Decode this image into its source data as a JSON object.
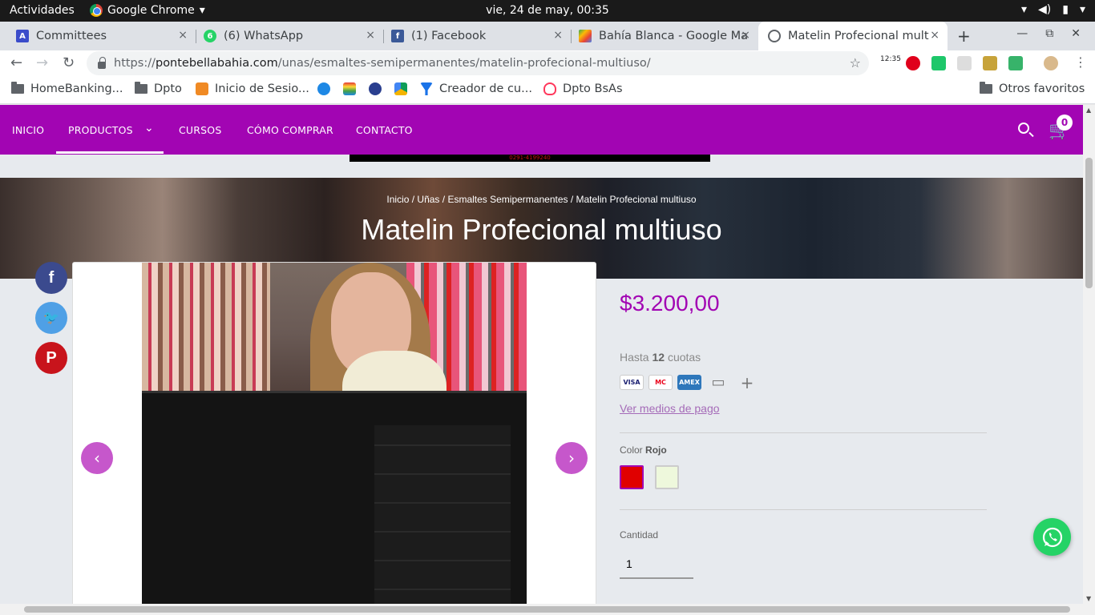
{
  "os": {
    "activities": "Actividades",
    "app_name": "Google Chrome",
    "app_menu_icon": "▾",
    "clock": "vie, 24 de may, 00:35"
  },
  "tabs": [
    {
      "title": "Committees",
      "close": "×"
    },
    {
      "title": "(6) WhatsApp",
      "badge": "6",
      "close": "×"
    },
    {
      "title": "(1) Facebook",
      "close": "×"
    },
    {
      "title": "Bahía Blanca - Google Ma",
      "close": "×"
    },
    {
      "title": "Matelin Profecional mult",
      "close": "×"
    }
  ],
  "browser": {
    "url_scheme": "https://",
    "url_host": "pontebellabahia.com",
    "url_path": "/unas/esmaltes-semipermanentes/matelin-profecional-multiuso/",
    "ext_clock_label": "12:35"
  },
  "bookmarks": [
    {
      "label": "HomeBanking...",
      "icon": "folder-icon"
    },
    {
      "label": "Dpto",
      "icon": "folder-icon"
    },
    {
      "label": "Inicio de Sesio...",
      "icon": "orange-icon"
    },
    {
      "label": "Creador de cu...",
      "icon": "funnel-icon"
    },
    {
      "label": "Dpto BsAs",
      "icon": "airbnb-icon"
    },
    {
      "label": "Otros favoritos",
      "icon": "folder-icon"
    }
  ],
  "site": {
    "nav": [
      "INICIO",
      "PRODUCTOS",
      "CURSOS",
      "CÓMO COMPRAR",
      "CONTACTO"
    ],
    "nav_dropdown_glyph": "⌄",
    "cart_count": "0",
    "banner_text": "0291-4199240",
    "breadcrumb": "Inicio / Uñas / Esmaltes Semipermanentes / Matelin Profecional multiuso",
    "title": "Matelin Profecional multiuso",
    "price": "$3.200,00",
    "cuotas_prefix": "Hasta",
    "cuotas_num": "12",
    "cuotas_suffix": "cuotas",
    "cards": [
      "VISA",
      "MC",
      "AMEX",
      "▭",
      "+"
    ],
    "medios_pago": "Ver medios de pago",
    "color_label": "Color",
    "color_value": "Rojo",
    "colors": [
      "#e00000",
      "#eef8dc"
    ],
    "cantidad_label": "Cantidad",
    "cantidad_value": "1",
    "accent": "#a205b3"
  }
}
